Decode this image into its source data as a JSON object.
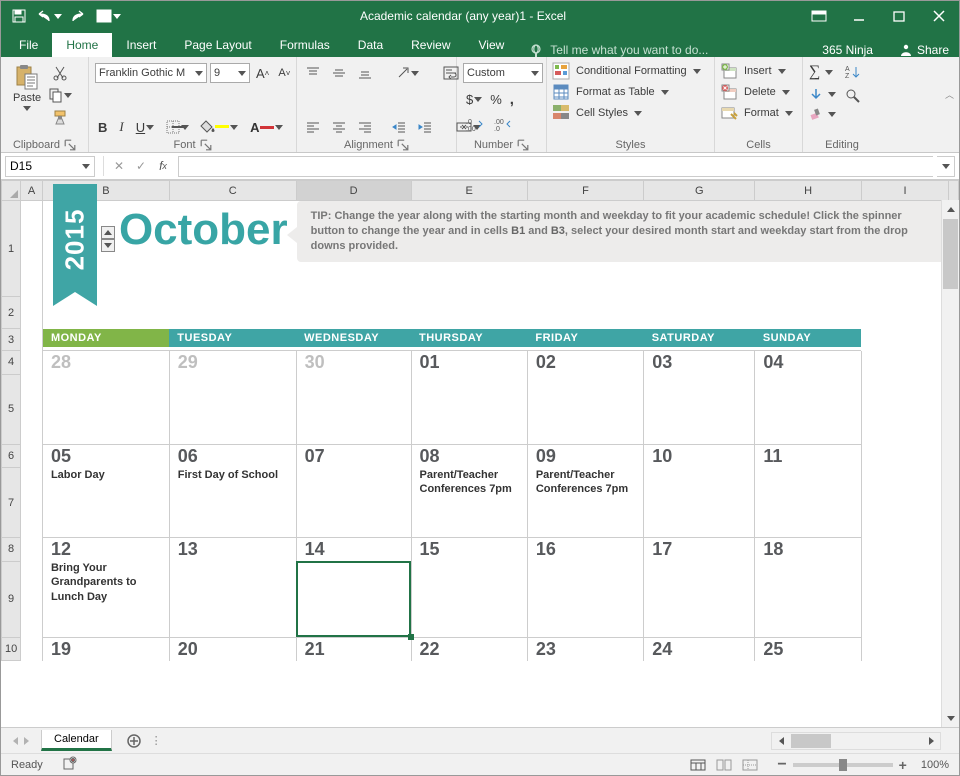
{
  "titlebar": {
    "title_prefix": "Academic calendar (any year)1 - ",
    "app_name": "Excel"
  },
  "identity": {
    "user": "365 Ninja",
    "share_label": "Share"
  },
  "tabs": {
    "file": "File",
    "items": [
      "Home",
      "Insert",
      "Page Layout",
      "Formulas",
      "Data",
      "Review",
      "View"
    ],
    "active": "Home",
    "tell_me": "Tell me what you want to do..."
  },
  "ribbon": {
    "clipboard": {
      "label": "Clipboard",
      "paste": "Paste"
    },
    "font": {
      "label": "Font",
      "family": "Franklin Gothic M",
      "size": "9"
    },
    "alignment": {
      "label": "Alignment"
    },
    "number": {
      "label": "Number",
      "format": "Custom"
    },
    "styles": {
      "label": "Styles",
      "cond": "Conditional Formatting",
      "table": "Format as Table",
      "cells": "Cell Styles"
    },
    "cells": {
      "label": "Cells",
      "insert": "Insert",
      "delete": "Delete",
      "format": "Format"
    },
    "editing": {
      "label": "Editing"
    }
  },
  "formula_bar": {
    "name_box": "D15",
    "formula": ""
  },
  "columns": [
    "A",
    "B",
    "C",
    "D",
    "E",
    "F",
    "G",
    "H",
    "I"
  ],
  "selected_column": "D",
  "rows": [
    "1",
    "2",
    "3",
    "4",
    "5",
    "6",
    "7",
    "8",
    "9",
    "10"
  ],
  "calendar": {
    "year": "2015",
    "month": "October",
    "tip": "TIP: Change the year along with the starting month and weekday to fit your academic schedule! Click the spinner button to change the year and in cells B1 and B3, select your desired month start and weekday start from the drop downs provided.",
    "tip_b1": "B1",
    "tip_b3": "B3",
    "days": [
      "MONDAY",
      "TUESDAY",
      "WEDNESDAY",
      "THURSDAY",
      "FRIDAY",
      "SATURDAY",
      "SUNDAY"
    ],
    "weeks": [
      {
        "nums": [
          "28",
          "29",
          "30",
          "01",
          "02",
          "03",
          "04"
        ],
        "faded": [
          true,
          true,
          true,
          false,
          false,
          false,
          false
        ],
        "events": [
          "",
          "",
          "",
          "",
          "",
          "",
          ""
        ]
      },
      {
        "nums": [
          "05",
          "06",
          "07",
          "08",
          "09",
          "10",
          "11"
        ],
        "faded": [
          false,
          false,
          false,
          false,
          false,
          false,
          false
        ],
        "events": [
          "Labor Day",
          "First Day of School",
          "",
          "Parent/Teacher Conferences 7pm",
          "Parent/Teacher Conferences 7pm",
          "",
          ""
        ]
      },
      {
        "nums": [
          "12",
          "13",
          "14",
          "15",
          "16",
          "17",
          "18"
        ],
        "faded": [
          false,
          false,
          false,
          false,
          false,
          false,
          false
        ],
        "events": [
          "Bring Your Grandparents to Lunch Day",
          "",
          "",
          "",
          "",
          "",
          ""
        ]
      },
      {
        "nums": [
          "19",
          "20",
          "21",
          "22",
          "23",
          "24",
          "25"
        ],
        "faded": [
          false,
          false,
          false,
          false,
          false,
          false,
          false
        ],
        "events": [
          "",
          "",
          "",
          "",
          "",
          "",
          ""
        ]
      }
    ]
  },
  "sheet_tabs": {
    "active": "Calendar"
  },
  "status": {
    "ready": "Ready",
    "zoom": "100%"
  }
}
